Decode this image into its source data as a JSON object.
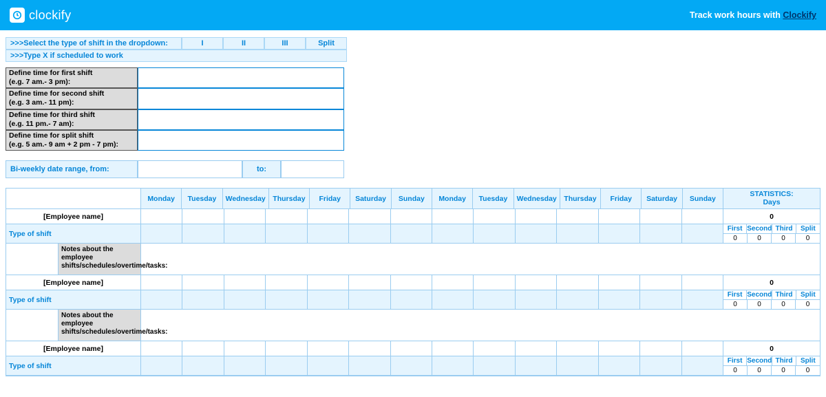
{
  "header": {
    "brand": "clockify",
    "tagline_prefix": "Track work hours with ",
    "tagline_link": "Clockify"
  },
  "instructions": {
    "line1": ">>>Select the type of shift in the dropdown:",
    "line2": ">>>Type X if scheduled to work",
    "opts": [
      "I",
      "II",
      "III",
      "Split"
    ]
  },
  "defs": [
    {
      "label": "Define time for first shift\n(e.g. 7 am.- 3 pm):",
      "value": ""
    },
    {
      "label": "Define time for second shift\n(e.g. 3 am.- 11 pm):",
      "value": ""
    },
    {
      "label": "Define time for third shift\n(e.g. 11 pm.- 7 am):",
      "value": ""
    },
    {
      "label": "Define time for split shift\n(e.g. 5 am.- 9 am + 2 pm - 7 pm):",
      "value": ""
    }
  ],
  "range": {
    "from_label": "Bi-weekly date range, from:",
    "from_value": "",
    "to_label": "to:",
    "to_value": ""
  },
  "days": [
    "Monday",
    "Tuesday",
    "Wednesday",
    "Thursday",
    "Friday",
    "Saturday",
    "Sunday",
    "Monday",
    "Tuesday",
    "Wednesday",
    "Thursday",
    "Friday",
    "Saturday",
    "Sunday"
  ],
  "stats_header": {
    "l1": "STATISTICS:",
    "l2": "Days"
  },
  "mini_headers": [
    "First",
    "Second",
    "Third",
    "Split"
  ],
  "labels": {
    "type_of_shift": "Type of shift",
    "notes": "Notes about the employee shifts/schedules/overtime/tasks:"
  },
  "employees": [
    {
      "name": "[Employee name]",
      "total_days": "0",
      "mini": [
        "0",
        "0",
        "0",
        "0"
      ]
    },
    {
      "name": "[Employee name]",
      "total_days": "0",
      "mini": [
        "0",
        "0",
        "0",
        "0"
      ]
    },
    {
      "name": "[Employee name]",
      "total_days": "0",
      "mini": [
        "0",
        "0",
        "0",
        "0"
      ]
    }
  ]
}
